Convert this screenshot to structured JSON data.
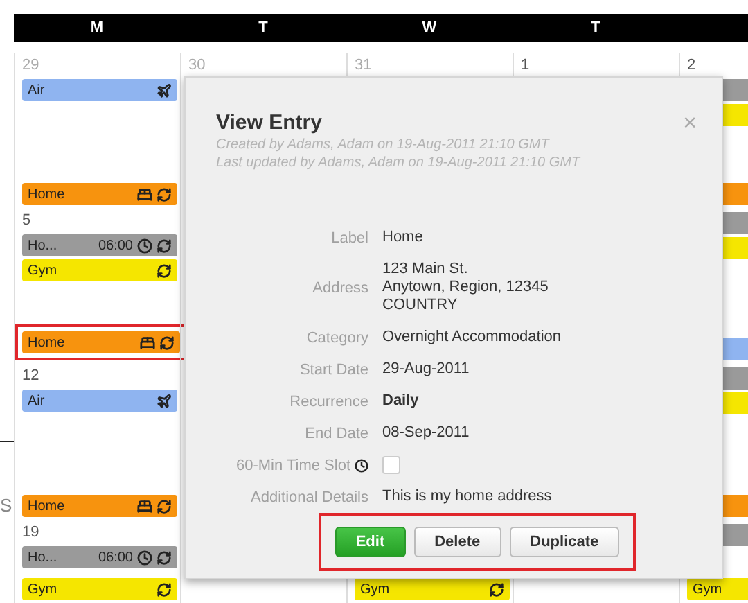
{
  "calendar": {
    "days": [
      "M",
      "T",
      "W",
      "T"
    ],
    "weeks": [
      {
        "cells": [
          {
            "date": "29",
            "other_month": true,
            "events": [
              {
                "kind": "flight",
                "label": "Air",
                "color": "#8fb4f0"
              },
              {
                "kind": "lodging",
                "label": "Home",
                "color": "#f7930e"
              }
            ]
          },
          {
            "date": "30",
            "other_month": true
          },
          {
            "date": "31",
            "other_month": true
          },
          {
            "date": "1",
            "other_month": false
          },
          {
            "date": "2",
            "other_month": false,
            "events": [
              {
                "kind": "bar",
                "color": "#9a9a9a"
              },
              {
                "kind": "bar",
                "color": "#f5e600"
              },
              {
                "kind": "bar",
                "color": "#f7930e"
              }
            ]
          }
        ]
      },
      {
        "cells": [
          {
            "date": "5",
            "other_month": false,
            "events": [
              {
                "kind": "timed",
                "label": "Ho...",
                "time": "06:00",
                "color": "#9a9a9a"
              },
              {
                "kind": "recurring",
                "label": "Gym",
                "color": "#f5e600"
              },
              {
                "kind": "lodging",
                "label": "Home",
                "color": "#f7930e",
                "highlighted": true
              }
            ]
          },
          {},
          {},
          {},
          {
            "events": [
              {
                "kind": "bar",
                "color": "#9a9a9a"
              },
              {
                "kind": "bar",
                "color": "#f5e600"
              },
              {
                "kind": "bar",
                "color": "#8fb4f0"
              }
            ]
          }
        ]
      },
      {
        "cells": [
          {
            "date": "12",
            "other_month": false,
            "events": [
              {
                "kind": "flight",
                "label": "Air",
                "color": "#8fb4f0"
              },
              {
                "kind": "lodging",
                "label": "Home",
                "color": "#f7930e"
              }
            ]
          },
          {},
          {},
          {},
          {
            "events": [
              {
                "kind": "bar",
                "color": "#9a9a9a"
              },
              {
                "kind": "bar",
                "color": "#f5e600"
              },
              {
                "kind": "bar",
                "color": "#f7930e"
              }
            ]
          }
        ]
      },
      {
        "cells": [
          {
            "date": "19",
            "other_month": false,
            "events": [
              {
                "kind": "timed",
                "label": "Ho...",
                "time": "06:00",
                "color": "#9a9a9a"
              },
              {
                "kind": "recurring",
                "label": "Gym",
                "color": "#f5e600"
              }
            ]
          },
          {},
          {
            "events": [
              {
                "kind": "recurring",
                "label": "Gym",
                "color": "#f5e600"
              }
            ]
          },
          {},
          {
            "events": [
              {
                "kind": "bar",
                "color": "#9a9a9a"
              },
              {
                "kind": "bar",
                "label": "Gym",
                "color": "#f5e600"
              }
            ]
          }
        ]
      }
    ]
  },
  "side_text": "S",
  "dialog": {
    "title": "View Entry",
    "close": "×",
    "meta": [
      "Created by Adams, Adam on 19-Aug-2011 21:10 GMT",
      "Last updated by Adams, Adam on 19-Aug-2011 21:10 GMT"
    ],
    "fields": [
      {
        "kind": "text",
        "label": "Label",
        "value": "Home"
      },
      {
        "kind": "text",
        "label": "Address",
        "lines": [
          "123 Main St.",
          "Anytown, Region, 12345",
          "COUNTRY"
        ]
      },
      {
        "kind": "text",
        "label": "Category",
        "value": "Overnight Accommodation"
      },
      {
        "kind": "text",
        "label": "Start Date",
        "value": "29-Aug-2011"
      },
      {
        "kind": "text",
        "label": "Recurrence",
        "value": "Daily",
        "bold": true
      },
      {
        "kind": "text",
        "label": "End Date",
        "value": "08-Sep-2011"
      },
      {
        "kind": "checkbox",
        "label": "60-Min Time Slot",
        "checked": false
      },
      {
        "kind": "text",
        "label": "Additional Details",
        "value": "This is my home address"
      }
    ],
    "buttons_highlighted": true,
    "buttons": [
      {
        "label": "Edit",
        "primary": true
      },
      {
        "label": "Delete",
        "primary": false
      },
      {
        "label": "Duplicate",
        "primary": false
      }
    ]
  }
}
